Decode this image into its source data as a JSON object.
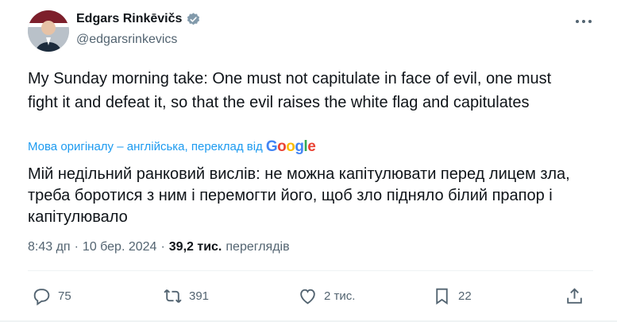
{
  "author": {
    "name": "Edgars Rinkēvičs",
    "handle": "@edgarsrinkevics"
  },
  "tweet": {
    "text": "My Sunday morning take: One must not capitulate in face of evil, one must fight it and defeat it, so that the evil raises the white flag and capitulates",
    "translate_note": "Мова оригіналу – англійська, переклад від",
    "translate_provider": "Google",
    "translated_text": "Мій недільний ранковий вислів: не можна капітулювати перед лицем зла, треба боротися з ним і перемогти його, щоб зло підняло білий прапор і капітулювало"
  },
  "meta": {
    "time": "8:43 дп",
    "separator1": "·",
    "date": "10 бер. 2024",
    "separator2": "·",
    "views_count": "39,2 тис.",
    "views_label": "переглядів"
  },
  "actions": {
    "replies": "75",
    "reposts": "391",
    "likes": "2 тис.",
    "bookmarks": "22"
  },
  "colors": {
    "accent": "#1d9bf0",
    "secondary_text": "#536471"
  }
}
